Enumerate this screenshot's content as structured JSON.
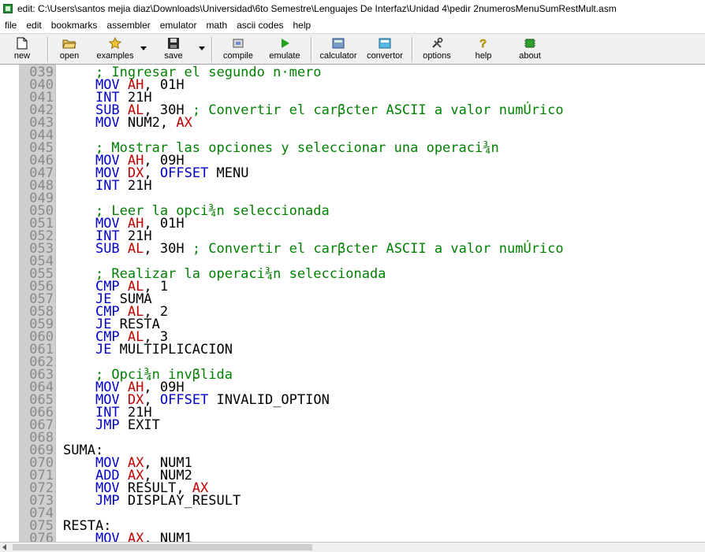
{
  "window": {
    "title": "edit: C:\\Users\\santos mejia diaz\\Downloads\\Universidad\\6to Semestre\\Lenguajes De Interfaz\\Unidad 4\\pedir 2numerosMenuSumRestMult.asm"
  },
  "menu": [
    "file",
    "edit",
    "bookmarks",
    "assembler",
    "emulator",
    "math",
    "ascii codes",
    "help"
  ],
  "toolbar": {
    "new": "new",
    "open": "open",
    "examples": "examples",
    "save": "save",
    "compile": "compile",
    "emulate": "emulate",
    "calculator": "calculator",
    "convertor": "convertor",
    "options": "options",
    "help": "help",
    "about": "about"
  },
  "colors": {
    "keyword": "#0000cc",
    "register": "#c00000",
    "comment": "#008000",
    "gutter": "#cfcfcf"
  },
  "lines": [
    {
      "n": "039",
      "segs": [
        {
          "t": "    "
        },
        {
          "t": "; Ingresar el segundo n·mero",
          "c": "cm"
        }
      ]
    },
    {
      "n": "040",
      "segs": [
        {
          "t": "    "
        },
        {
          "t": "MOV",
          "c": "kw"
        },
        {
          "t": " "
        },
        {
          "t": "AH",
          "c": "reg"
        },
        {
          "t": ", 01H"
        }
      ]
    },
    {
      "n": "041",
      "segs": [
        {
          "t": "    "
        },
        {
          "t": "INT",
          "c": "kw"
        },
        {
          "t": " 21H"
        }
      ]
    },
    {
      "n": "042",
      "segs": [
        {
          "t": "    "
        },
        {
          "t": "SUB",
          "c": "kw"
        },
        {
          "t": " "
        },
        {
          "t": "AL",
          "c": "reg"
        },
        {
          "t": ", 30H "
        },
        {
          "t": "; Convertir el carβcter ASCII a valor numÚrico",
          "c": "cm"
        }
      ]
    },
    {
      "n": "043",
      "segs": [
        {
          "t": "    "
        },
        {
          "t": "MOV",
          "c": "kw"
        },
        {
          "t": " NUM2, "
        },
        {
          "t": "AX",
          "c": "reg"
        }
      ]
    },
    {
      "n": "044",
      "segs": []
    },
    {
      "n": "045",
      "segs": [
        {
          "t": "    "
        },
        {
          "t": "; Mostrar las opciones y seleccionar una operaci¾n",
          "c": "cm"
        }
      ]
    },
    {
      "n": "046",
      "segs": [
        {
          "t": "    "
        },
        {
          "t": "MOV",
          "c": "kw"
        },
        {
          "t": " "
        },
        {
          "t": "AH",
          "c": "reg"
        },
        {
          "t": ", 09H"
        }
      ]
    },
    {
      "n": "047",
      "segs": [
        {
          "t": "    "
        },
        {
          "t": "MOV",
          "c": "kw"
        },
        {
          "t": " "
        },
        {
          "t": "DX",
          "c": "reg"
        },
        {
          "t": ", "
        },
        {
          "t": "OFFSET",
          "c": "kw"
        },
        {
          "t": " MENU"
        }
      ]
    },
    {
      "n": "048",
      "segs": [
        {
          "t": "    "
        },
        {
          "t": "INT",
          "c": "kw"
        },
        {
          "t": " 21H"
        }
      ]
    },
    {
      "n": "049",
      "segs": []
    },
    {
      "n": "050",
      "segs": [
        {
          "t": "    "
        },
        {
          "t": "; Leer la opci¾n seleccionada",
          "c": "cm"
        }
      ]
    },
    {
      "n": "051",
      "segs": [
        {
          "t": "    "
        },
        {
          "t": "MOV",
          "c": "kw"
        },
        {
          "t": " "
        },
        {
          "t": "AH",
          "c": "reg"
        },
        {
          "t": ", 01H"
        }
      ]
    },
    {
      "n": "052",
      "segs": [
        {
          "t": "    "
        },
        {
          "t": "INT",
          "c": "kw"
        },
        {
          "t": " 21H"
        }
      ]
    },
    {
      "n": "053",
      "segs": [
        {
          "t": "    "
        },
        {
          "t": "SUB",
          "c": "kw"
        },
        {
          "t": " "
        },
        {
          "t": "AL",
          "c": "reg"
        },
        {
          "t": ", 30H "
        },
        {
          "t": "; Convertir el carβcter ASCII a valor numÚrico",
          "c": "cm"
        }
      ]
    },
    {
      "n": "054",
      "segs": []
    },
    {
      "n": "055",
      "segs": [
        {
          "t": "    "
        },
        {
          "t": "; Realizar la operaci¾n seleccionada",
          "c": "cm"
        }
      ]
    },
    {
      "n": "056",
      "segs": [
        {
          "t": "    "
        },
        {
          "t": "CMP",
          "c": "kw"
        },
        {
          "t": " "
        },
        {
          "t": "AL",
          "c": "reg"
        },
        {
          "t": ", 1"
        }
      ]
    },
    {
      "n": "057",
      "segs": [
        {
          "t": "    "
        },
        {
          "t": "JE",
          "c": "kw"
        },
        {
          "t": " SUMA"
        }
      ]
    },
    {
      "n": "058",
      "segs": [
        {
          "t": "    "
        },
        {
          "t": "CMP",
          "c": "kw"
        },
        {
          "t": " "
        },
        {
          "t": "AL",
          "c": "reg"
        },
        {
          "t": ", 2"
        }
      ]
    },
    {
      "n": "059",
      "segs": [
        {
          "t": "    "
        },
        {
          "t": "JE",
          "c": "kw"
        },
        {
          "t": " RESTA"
        }
      ]
    },
    {
      "n": "060",
      "segs": [
        {
          "t": "    "
        },
        {
          "t": "CMP",
          "c": "kw"
        },
        {
          "t": " "
        },
        {
          "t": "AL",
          "c": "reg"
        },
        {
          "t": ", 3"
        }
      ]
    },
    {
      "n": "061",
      "segs": [
        {
          "t": "    "
        },
        {
          "t": "JE",
          "c": "kw"
        },
        {
          "t": " MULTIPLICACION"
        }
      ]
    },
    {
      "n": "062",
      "segs": []
    },
    {
      "n": "063",
      "segs": [
        {
          "t": "    "
        },
        {
          "t": "; Opci¾n invβlida",
          "c": "cm"
        }
      ]
    },
    {
      "n": "064",
      "segs": [
        {
          "t": "    "
        },
        {
          "t": "MOV",
          "c": "kw"
        },
        {
          "t": " "
        },
        {
          "t": "AH",
          "c": "reg"
        },
        {
          "t": ", 09H"
        }
      ]
    },
    {
      "n": "065",
      "segs": [
        {
          "t": "    "
        },
        {
          "t": "MOV",
          "c": "kw"
        },
        {
          "t": " "
        },
        {
          "t": "DX",
          "c": "reg"
        },
        {
          "t": ", "
        },
        {
          "t": "OFFSET",
          "c": "kw"
        },
        {
          "t": " INVALID_OPTION"
        }
      ]
    },
    {
      "n": "066",
      "segs": [
        {
          "t": "    "
        },
        {
          "t": "INT",
          "c": "kw"
        },
        {
          "t": " 21H"
        }
      ]
    },
    {
      "n": "067",
      "segs": [
        {
          "t": "    "
        },
        {
          "t": "JMP",
          "c": "kw"
        },
        {
          "t": " EXIT"
        }
      ]
    },
    {
      "n": "068",
      "segs": []
    },
    {
      "n": "069",
      "segs": [
        {
          "t": "SUMA:"
        }
      ]
    },
    {
      "n": "070",
      "segs": [
        {
          "t": "    "
        },
        {
          "t": "MOV",
          "c": "kw"
        },
        {
          "t": " "
        },
        {
          "t": "AX",
          "c": "reg"
        },
        {
          "t": ", NUM1"
        }
      ]
    },
    {
      "n": "071",
      "segs": [
        {
          "t": "    "
        },
        {
          "t": "ADD",
          "c": "kw"
        },
        {
          "t": " "
        },
        {
          "t": "AX",
          "c": "reg"
        },
        {
          "t": ", NUM2"
        }
      ]
    },
    {
      "n": "072",
      "segs": [
        {
          "t": "    "
        },
        {
          "t": "MOV",
          "c": "kw"
        },
        {
          "t": " RESULT, "
        },
        {
          "t": "AX",
          "c": "reg"
        }
      ]
    },
    {
      "n": "073",
      "segs": [
        {
          "t": "    "
        },
        {
          "t": "JMP",
          "c": "kw"
        },
        {
          "t": " DISPLAY_RESULT"
        }
      ]
    },
    {
      "n": "074",
      "segs": []
    },
    {
      "n": "075",
      "segs": [
        {
          "t": "RESTA:"
        }
      ]
    },
    {
      "n": "076",
      "segs": [
        {
          "t": "    "
        },
        {
          "t": "MOV",
          "c": "kw"
        },
        {
          "t": " "
        },
        {
          "t": "AX",
          "c": "reg"
        },
        {
          "t": ", NUM1"
        }
      ]
    }
  ]
}
